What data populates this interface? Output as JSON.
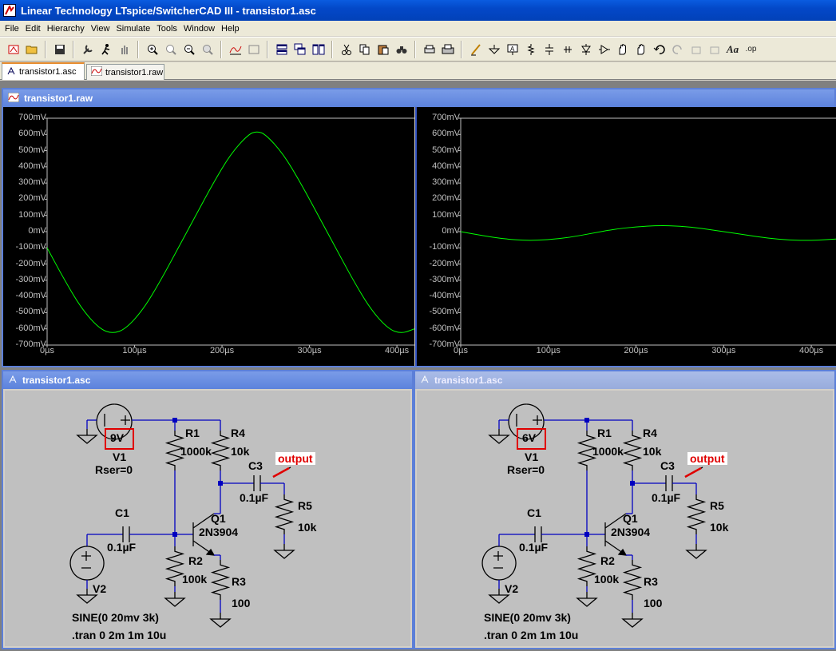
{
  "app": {
    "title": "Linear Technology LTspice/SwitcherCAD III - transistor1.asc"
  },
  "menu": [
    "File",
    "Edit",
    "Hierarchy",
    "View",
    "Simulate",
    "Tools",
    "Window",
    "Help"
  ],
  "toolbar_icons": [
    "open-icon",
    "folder-icon",
    "save-icon",
    "control-panel-icon",
    "run-icon",
    "halt-icon",
    "zoom-in-icon",
    "zoom-pan-icon",
    "zoom-out-icon",
    "zoom-fit-icon",
    "autorange-icon",
    "bode-icon",
    "tile-horizontal-icon",
    "cascade-icon",
    "tile-vertical-icon",
    "cut-icon",
    "copy-icon",
    "paste-icon",
    "find-icon",
    "print-preview-icon",
    "print-icon",
    "wire-icon",
    "ground-icon",
    "label-icon",
    "resistor-icon",
    "capacitor-icon",
    "inductor-icon",
    "diode-icon",
    "component-icon",
    "move-icon",
    "drag-icon",
    "undo-icon",
    "redo-icon",
    "rotate-icon",
    "mirror-icon",
    "text-icon",
    "spice-directive-icon"
  ],
  "tabs": [
    {
      "label": "transistor1.asc"
    },
    {
      "label": "transistor1.raw"
    }
  ],
  "waveform_window": {
    "title": "transistor1.raw"
  },
  "plots": [
    {
      "y_ticks": [
        "700mV",
        "600mV",
        "500mV",
        "400mV",
        "300mV",
        "200mV",
        "100mV",
        "0mV",
        "-100mV",
        "-200mV",
        "-300mV",
        "-400mV",
        "-500mV",
        "-600mV",
        "-700mV"
      ],
      "x_ticks": [
        "0µs",
        "100µs",
        "200µs",
        "300µs",
        "400µs"
      ]
    },
    {
      "y_ticks": [
        "700mV",
        "600mV",
        "500mV",
        "400mV",
        "300mV",
        "200mV",
        "100mV",
        "0mV",
        "-100mV",
        "-200mV",
        "-300mV",
        "-400mV",
        "-500mV",
        "-600mV",
        "-700mV"
      ],
      "x_ticks": [
        "0µs",
        "100µs",
        "200µs",
        "300µs",
        "400µs"
      ]
    }
  ],
  "chart_data": [
    {
      "type": "line",
      "ylim": [
        -700,
        700
      ],
      "xlim": [
        0,
        420
      ],
      "series": [
        {
          "color": "#00ff00",
          "x": [
            0,
            20,
            40,
            60,
            75,
            90,
            110,
            130,
            150,
            170,
            190,
            210,
            230,
            240,
            250,
            270,
            290,
            310,
            330,
            350,
            370,
            390,
            405,
            420
          ],
          "y": [
            -100,
            -300,
            -480,
            -600,
            -630,
            -600,
            -480,
            -300,
            -100,
            100,
            300,
            480,
            600,
            620,
            600,
            480,
            300,
            100,
            -100,
            -300,
            -480,
            -600,
            -630,
            -600
          ]
        }
      ]
    },
    {
      "type": "line",
      "ylim": [
        -700,
        700
      ],
      "xlim": [
        0,
        430
      ],
      "series": [
        {
          "color": "#00ff00",
          "x": [
            0,
            25,
            50,
            75,
            100,
            125,
            150,
            175,
            200,
            225,
            250,
            275,
            300,
            325,
            350,
            375,
            400,
            430
          ],
          "y": [
            0,
            -25,
            -45,
            -55,
            -50,
            -35,
            -10,
            15,
            30,
            38,
            35,
            20,
            0,
            -20,
            -40,
            -52,
            -55,
            -45
          ]
        }
      ]
    }
  ],
  "schematics": [
    {
      "title": "transistor1.asc",
      "v1_value": "9V",
      "v1_name": "V1",
      "v1_rser": "Rser=0",
      "r1": "R1",
      "r1_val": "1000k",
      "r4": "R4",
      "r4_val": "10k",
      "c3": "C3",
      "c3_val": "0.1µF",
      "output": "output",
      "r5": "R5",
      "r5_val": "10k",
      "c1": "C1",
      "c1_val": "0.1µF",
      "q1": "Q1",
      "q1_val": "2N3904",
      "r2": "R2",
      "r2_val": "100k",
      "r3": "R3",
      "r3_val": "100",
      "v2": "V2",
      "sine": "SINE(0 20mv 3k)",
      "tran": ".tran 0 2m 1m 10u"
    },
    {
      "title": "transistor1.asc",
      "v1_value": "6V",
      "v1_name": "V1",
      "v1_rser": "Rser=0",
      "r1": "R1",
      "r1_val": "1000k",
      "r4": "R4",
      "r4_val": "10k",
      "c3": "C3",
      "c3_val": "0.1µF",
      "output": "output",
      "r5": "R5",
      "r5_val": "10k",
      "c1": "C1",
      "c1_val": "0.1µF",
      "q1": "Q1",
      "q1_val": "2N3904",
      "r2": "R2",
      "r2_val": "100k",
      "r3": "R3",
      "r3_val": "100",
      "v2": "V2",
      "sine": "SINE(0 20mv 3k)",
      "tran": ".tran 0 2m 1m 10u"
    }
  ],
  "colors": {
    "wire": "#0000c0",
    "trace": "#00ff00",
    "highlight": "#e00000"
  }
}
